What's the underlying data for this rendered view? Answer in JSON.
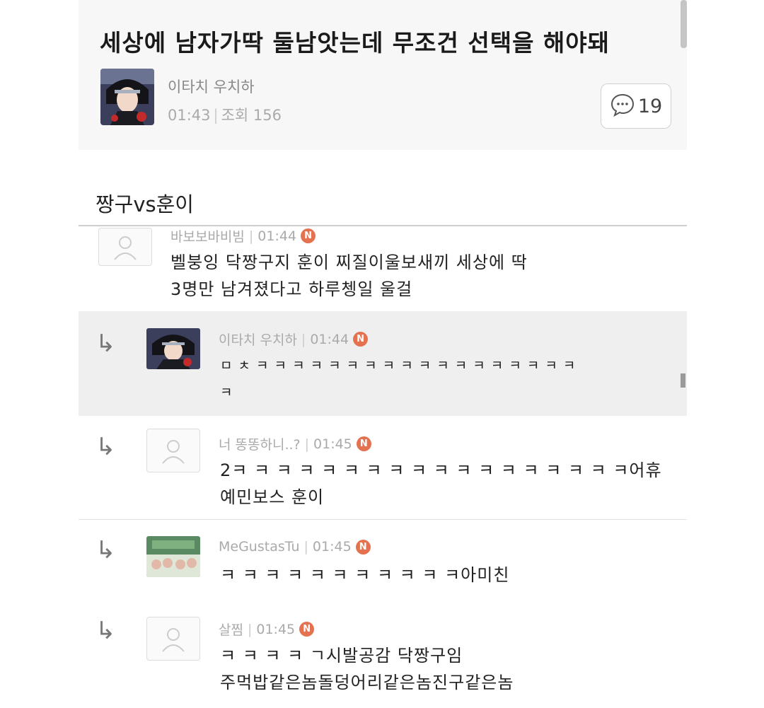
{
  "post": {
    "title": "세상에 남자가딱 둘남앗는데 무조건 선택을 해야돼",
    "author": "이타치 우치하",
    "time": "01:43",
    "views_label": "조회 156",
    "comment_count": "19",
    "body": "짱구vs훈이"
  },
  "comments": [
    {
      "author": "바보보바비빔",
      "time": "01:44",
      "badge": "N",
      "line1": "벨붕잉 닥짱구지 훈이 찌질이울보새끼 세상에 딱",
      "line2": "3명만 남겨졌다고 하루쳉일 울걸"
    },
    {
      "author": "이타치 우치하",
      "time": "01:44",
      "badge": "N",
      "line1": "ㅁ ㅊ ㅋ ㅋ ㅋ ㅋ ㅋ ㅋ ㅋ ㅋ ㅋ ㅋ ㅋ ㅋ ㅋ ㅋ ㅋ ㅋ ㅋ ㅋ",
      "line2": "ㅋ"
    },
    {
      "author": "너 똥똥하니..?",
      "time": "01:45",
      "badge": "N",
      "line1": "2ㅋ ㅋ ㅋ ㅋ ㅋ ㅋ ㅋ ㅋ ㅋ ㅋ ㅋ ㅋ ㅋ ㅋ ㅋ ㅋ ㅋ ㅋ어휴",
      "line2": "예민보스 훈이"
    },
    {
      "author": "MeGustasTu",
      "time": "01:45",
      "badge": "N",
      "line1": "ㅋ ㅋ ㅋ ㅋ ㅋ ㅋ ㅋ ㅋ ㅋ ㅋ ㅋ아미친"
    },
    {
      "author": "살찜",
      "time": "01:45",
      "badge": "N",
      "line1": "ㅋ ㅋ ㅋ ㅋ ㄱ시발공감 닥짱구임",
      "line2": "주먹밥같은놈돌덩어리같은놈진구같은놈"
    }
  ],
  "icons": {
    "reply": "↳",
    "comment": "speech-bubble-icon",
    "default_avatar": "person-outline-icon"
  },
  "colors": {
    "new_badge": "#e4714f",
    "highlight_row": "#efefef"
  }
}
